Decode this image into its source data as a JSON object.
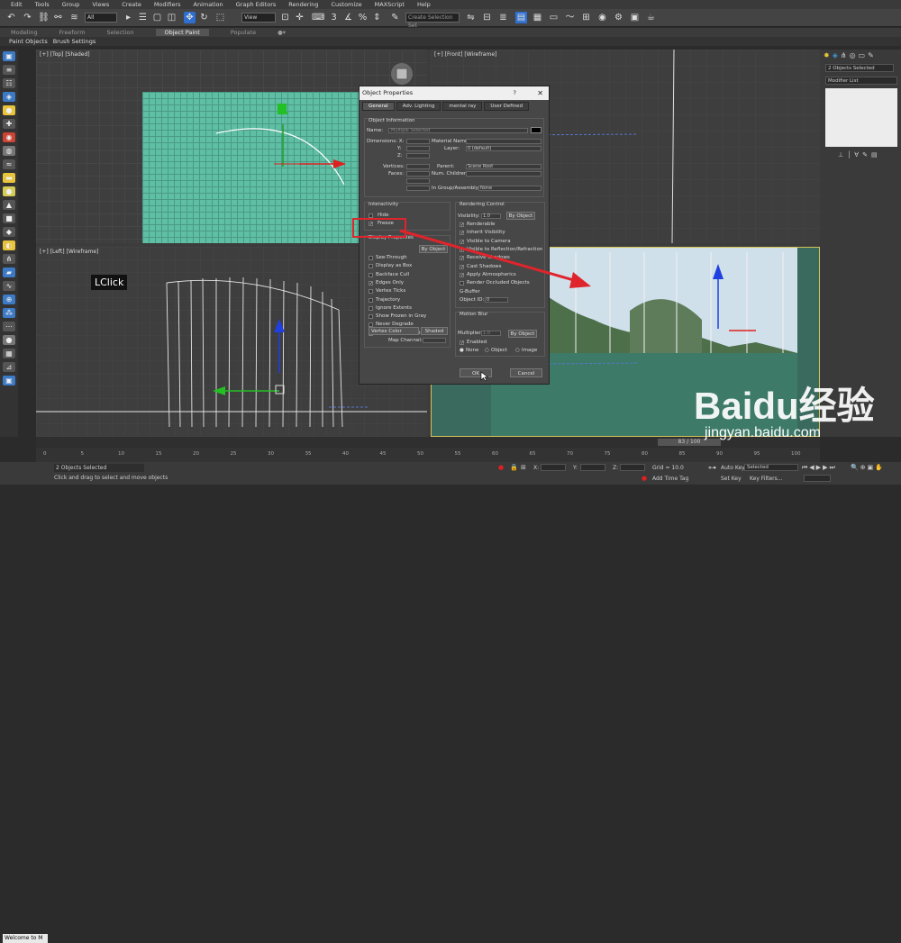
{
  "menu": [
    "Edit",
    "Tools",
    "Group",
    "Views",
    "Create",
    "Modifiers",
    "Animation",
    "Graph Editors",
    "Rendering",
    "Customize",
    "MAXScript",
    "Help"
  ],
  "toolbar": {
    "selection_filter": "All",
    "ref_coord": "View",
    "named_selection": "Create Selection Set"
  },
  "ribbon": {
    "tabs": [
      "Modeling",
      "Freeform",
      "Selection",
      "Object Paint",
      "Populate"
    ],
    "active": "Object Paint",
    "sub": [
      "Paint Objects",
      "Brush Settings"
    ]
  },
  "viewports": {
    "top": "[+] [Top] [Shaded]",
    "front": "[+] [Front] [Wireframe]",
    "left": "[+] [Left] [Wireframe]"
  },
  "overlay_label": "LClick",
  "right_panel": {
    "selection": "2 Objects Selected",
    "modifier_list": "Modifier List"
  },
  "dialog": {
    "title": "Object Properties",
    "help": "?",
    "close": "✕",
    "tabs": [
      "General",
      "Adv. Lighting",
      "mental ray",
      "User Defined"
    ],
    "object_info": {
      "label": "Object Information",
      "name_label": "Name:",
      "name_value": "Multiple Selected",
      "dimensions": "Dimensions: X:",
      "y": "Y:",
      "z": "Z:",
      "material_name": "Material Name:",
      "layer": "Layer:",
      "layer_value": "0 (default)",
      "vertices": "Vertices:",
      "faces": "Faces:",
      "parent": "Parent:",
      "parent_value": "Scene Root",
      "num_children": "Num. Children:",
      "group": "In Group/Assembly:",
      "group_value": "None"
    },
    "interactivity": {
      "label": "Interactivity",
      "hide": "Hide",
      "freeze": "Freeze"
    },
    "display_props": {
      "label": "Display Properties",
      "by_object": "By Object",
      "items": [
        "See-Through",
        "Display as Box",
        "Backface Cull",
        "Edges Only",
        "Vertex Ticks",
        "Trajectory",
        "Ignore Extents",
        "Show Frozen in Gray",
        "Never Degrade",
        "Vertex Channel Display"
      ],
      "vertex_color": "Vertex Color",
      "shaded": "Shaded",
      "map_channel": "Map Channel:"
    },
    "rendering": {
      "label": "Rendering Control",
      "visibility": "Visibility:",
      "visibility_value": "1.0",
      "by_object": "By Object",
      "items": [
        "Renderable",
        "Inherit Visibility",
        "Visible to Camera",
        "Visible to Reflection/Refraction",
        "Receive Shadows",
        "Cast Shadows",
        "Apply Atmospherics",
        "Render Occluded Objects"
      ],
      "gbuffer": "G-Buffer",
      "object_id": "Object ID:",
      "object_id_value": "0"
    },
    "motion_blur": {
      "label": "Motion Blur",
      "multiplier": "Multiplier:",
      "multiplier_value": "1.0",
      "by_object": "By Object",
      "enabled": "Enabled",
      "none": "None",
      "object": "Object",
      "image": "Image"
    },
    "ok": "OK",
    "cancel": "Cancel"
  },
  "timeline": {
    "frame": "83 / 100",
    "ticks": [
      "0",
      "5",
      "10",
      "15",
      "20",
      "25",
      "30",
      "35",
      "40",
      "45",
      "50",
      "55",
      "60",
      "65",
      "70",
      "75",
      "80",
      "85",
      "90",
      "95",
      "100"
    ]
  },
  "status": {
    "selected": "2 Objects Selected",
    "prompt": "Click and drag to select and move objects",
    "x_label": "X:",
    "y_label": "Y:",
    "z_label": "Z:",
    "grid": "Grid = 10.0",
    "auto_key": "Auto Key",
    "set_key": "Set Key",
    "selected_dd": "Selected",
    "key_filters": "Key Filters...",
    "add_time_tag": "Add Time Tag",
    "listener": "Welcome to M"
  },
  "watermark": {
    "brand": "Baidu",
    "cn": "经验",
    "url": "jingyan.baidu.com"
  },
  "colors": {
    "annotation_red": "#e0242c",
    "plane": "#5fbfa4",
    "axis_blue": "#1f3fe0",
    "axis_green": "#22c022",
    "axis_red": "#e02020"
  }
}
